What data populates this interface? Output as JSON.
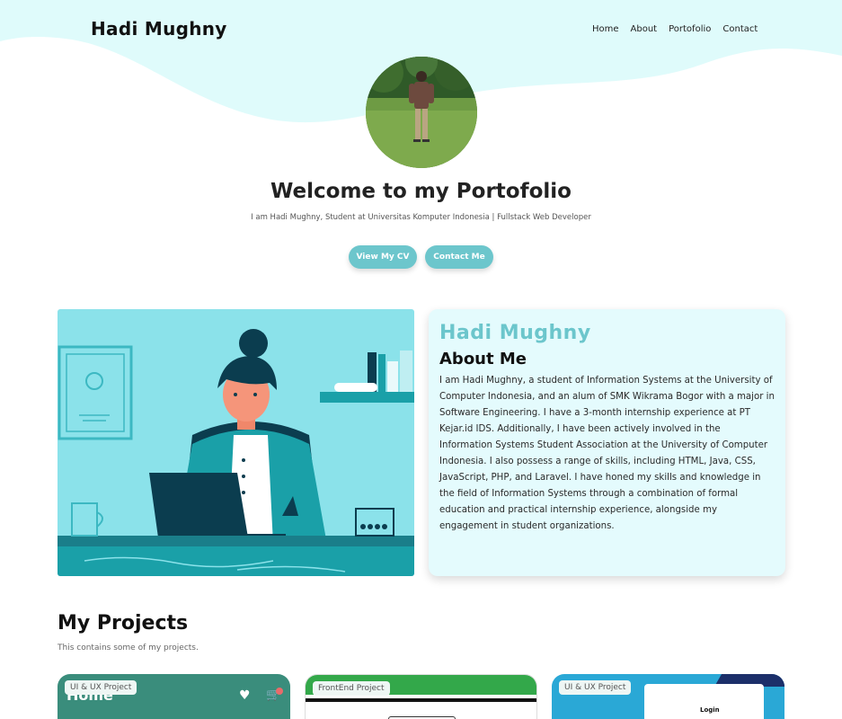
{
  "header": {
    "brand": "Hadi Mughny",
    "nav": [
      "Home",
      "About",
      "Portofolio",
      "Contact"
    ]
  },
  "hero": {
    "title": "Welcome to my Portofolio",
    "subtitle": "I am Hadi Mughny, Student at Universitas Komputer Indonesia | Fullstack Web Developer",
    "cv_button": "View My CV",
    "contact_button": "Contact Me"
  },
  "about": {
    "name": "Hadi Mughny",
    "heading": "About Me",
    "text": "I am Hadi Mughny, a student of Information Systems at the University of Computer Indonesia, and an alum of SMK Wikrama Bogor with a major in Software Engineering. I have a 3-month internship experience at PT Kejar.id IDS. Additionally, I have been actively involved in the Information Systems Student Association at the University of Computer Indonesia. I also possess a range of skills, including HTML, Java, CSS, JavaScript, PHP, and Laravel. I have honed my skills and knowledge in the field of Information Systems through a combination of formal education and practical internship experience, alongside my engagement in student organizations."
  },
  "projects": {
    "title": "My Projects",
    "subtitle": "This contains some of my projects.",
    "cards": [
      {
        "tag": "UI & UX Project",
        "preview_text": "Home"
      },
      {
        "tag": "FrontEnd Project",
        "preview_text": ""
      },
      {
        "tag": "UI & UX Project",
        "preview_text": "Login"
      }
    ]
  },
  "colors": {
    "accent": "#6cc6cc",
    "wave": "#dffbfb",
    "about_bg": "#e4fbfd"
  }
}
